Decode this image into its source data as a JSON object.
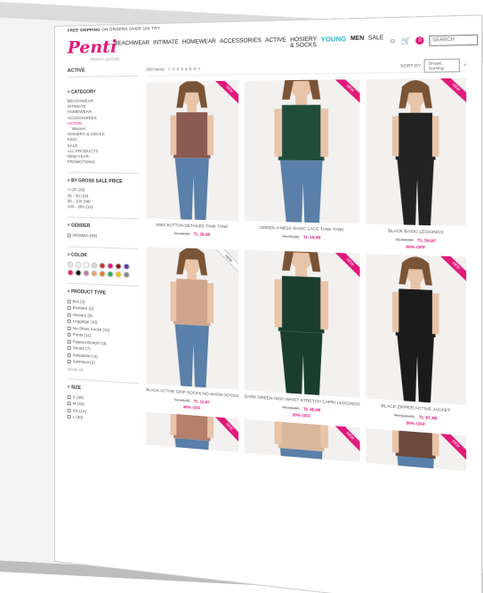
{
  "promo": {
    "bold": "FREE SHIPPING",
    "rest": "ON ORDERS OVER 100 TRY"
  },
  "logo": "Penti",
  "breadcrumb": "PENTI  /  ACTIVE",
  "nav": [
    "BEACHWEAR",
    "INTIMATE",
    "HOMEWEAR",
    "ACCESSORIES",
    "ACTIVE",
    "HOSIERY & SOCKS",
    "YOUNG",
    "MEN",
    "SALE"
  ],
  "search": {
    "placeholder": "SEARCH"
  },
  "cart_count": "0",
  "colors": {
    "brand": "#e0197a",
    "young": "#2ab7c7"
  },
  "sidebar": {
    "title": "ACTIVE",
    "category": {
      "title": "CATEGORY",
      "items": [
        "BEACHWEAR",
        "INTIMATE",
        "HOMEWEAR",
        "ACCESSORIES",
        "ACTIVE",
        "Women",
        "HOSIERY & SOCKS",
        "KIDS",
        "SALE",
        "ALL PRODUCTS",
        "NEW YEAR",
        "PROMOTIONS"
      ]
    },
    "price": {
      "title": "BY GROSS SALE PRICE",
      "items": [
        "<=25 (26)",
        "26 - 50 (34)",
        "50 - 100 (38)",
        "100 - 200 (12)"
      ]
    },
    "gender": {
      "title": "GENDER",
      "items": [
        "WOMEN (89)"
      ]
    },
    "color": {
      "title": "COLOR",
      "swatches": [
        "#e6e6e6",
        "#f2f2f2",
        "#ffffff",
        "#d8d8d8",
        "#c0392b",
        "#e0197a",
        "#8b1a1a",
        "#5b3ea8",
        "#e91e63",
        "#111111",
        "#c27ba0",
        "#f0a070",
        "#e67e22",
        "#27ae60",
        "#f1c40f",
        "#7f8c8d"
      ]
    },
    "type": {
      "title": "PRODUCT TYPE",
      "items": [
        "Bra (3)",
        "Bustiere (2)",
        "Hosiery (9)",
        "Leggings (10)",
        "No-Show Socks (11)",
        "Pants (11)",
        "Pyjama Bottom (3)",
        "Shorts (7)",
        "Sweatshirt (4)",
        "Swimsuit (2)"
      ],
      "more": "Show all"
    },
    "size": {
      "title": "SIZE",
      "items": [
        "S (30)",
        "M (32)",
        "XS (14)",
        "L (20)"
      ]
    }
  },
  "toolbar": {
    "count": "200 items",
    "pages": [
      "<",
      "1",
      "2",
      "3",
      "4",
      "5",
      "6",
      ">"
    ],
    "sort_label": "SORT BY",
    "sort_value": "Smart Sorting"
  },
  "products": [
    {
      "name": "RIBS BUTTON DETAILED TANK TANK",
      "old": "TL 59,99",
      "price": "TL 39,99",
      "off": "",
      "ribbon": "NEW",
      "tone": "#8b5a52"
    },
    {
      "name": "GREEN V-NECK BASIC LACE TANK TANK",
      "old": "TL 79,99",
      "price": "TL 19,99",
      "off": "",
      "ribbon": "NEW",
      "tone": "#1f4d3a"
    },
    {
      "name": "BLACK BASIC LEGGINGS",
      "old": "TL 99,99",
      "price": "TL 59,97",
      "off": "40% OFF",
      "ribbon": "NEW",
      "tone": "#222"
    },
    {
      "name": "BLACK ACTIVE GRIP SOCKS NO-SHOW SOCKS",
      "old": "TL 19,99",
      "price": "TL 11,97",
      "off": "40% OFF",
      "ribbon": "NEW",
      "tone": "#cfa58e"
    },
    {
      "name": "DARK GREEN HIGH WAIST STRETCH CAPRI LEGGINGS",
      "old": "TL 69,99",
      "price": "TL 48,99",
      "off": "30% OFF",
      "ribbon": "NEW",
      "tone": "#1a3d30"
    },
    {
      "name": "BLACK ZIPPER ACTIVE JACKET",
      "old": "TL 139,99",
      "price": "TL 97,99",
      "off": "30% OFF",
      "ribbon": "NEW",
      "tone": "#1a1a1a"
    },
    {
      "name": "",
      "old": "",
      "price": "",
      "off": "",
      "ribbon": "NEW",
      "tone": "#b57f6e"
    },
    {
      "name": "",
      "old": "",
      "price": "",
      "off": "",
      "ribbon": "NEW",
      "tone": "#d9b89c"
    },
    {
      "name": "",
      "old": "",
      "price": "",
      "off": "",
      "ribbon": "NEW",
      "tone": "#6b4a3c"
    }
  ]
}
